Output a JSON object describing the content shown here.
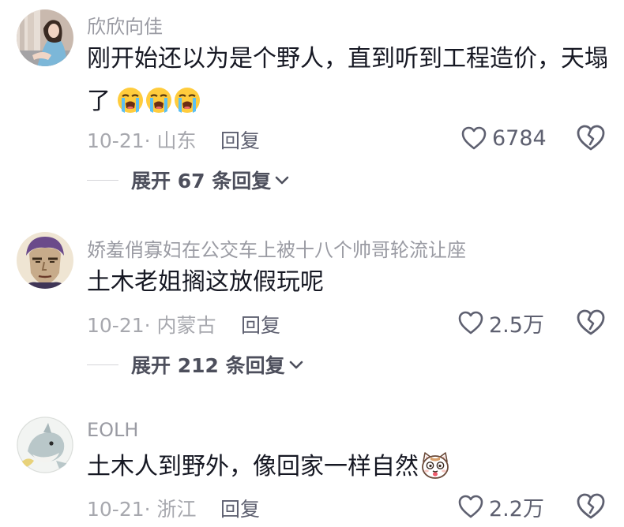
{
  "comments": [
    {
      "username": "欣欣向佳",
      "avatar_icon": "avatar-girl-photo",
      "text_line1": "刚开始还以为是个野人，直到听到工程造价，天塌",
      "text_line2": "了",
      "emojis": [
        "loudly-crying-face-emoji",
        "loudly-crying-face-emoji",
        "loudly-crying-face-emoji"
      ],
      "date_location": "10-21· 山东",
      "reply_label": "回复",
      "likes": "6784",
      "expand_label": "展开 67 条回复"
    },
    {
      "username": "娇羞俏寡妇在公交车上被十八个帅哥轮流让座",
      "avatar_icon": "avatar-anime-man",
      "text_line1": "土木老姐搁这放假玩呢",
      "date_location": "10-21· 内蒙古",
      "reply_label": "回复",
      "likes": "2.5万",
      "expand_label": "展开 212 条回复"
    },
    {
      "username": "EOLH",
      "avatar_icon": "avatar-cartoon-shark",
      "text_line1": "土木人到野外，像回家一样自然",
      "emojis": [
        "cat-face-emoji"
      ],
      "date_location": "10-21· 浙江",
      "reply_label": "回复",
      "likes": "2.2万"
    }
  ],
  "icons": {
    "like": "heart-outline-icon",
    "dislike": "broken-heart-icon",
    "expand": "chevron-down-icon"
  },
  "colors": {
    "username": "#9a9ba3",
    "text": "#161823",
    "meta": "#a7a8ae",
    "action": "#5e6070"
  }
}
